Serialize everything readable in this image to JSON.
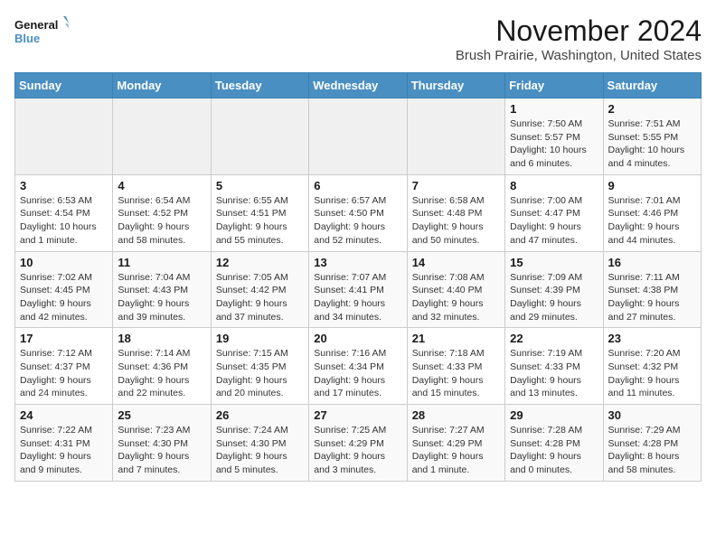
{
  "logo": {
    "line1": "General",
    "line2": "Blue"
  },
  "title": "November 2024",
  "subtitle": "Brush Prairie, Washington, United States",
  "days_of_week": [
    "Sunday",
    "Monday",
    "Tuesday",
    "Wednesday",
    "Thursday",
    "Friday",
    "Saturday"
  ],
  "weeks": [
    [
      {
        "day": "",
        "info": ""
      },
      {
        "day": "",
        "info": ""
      },
      {
        "day": "",
        "info": ""
      },
      {
        "day": "",
        "info": ""
      },
      {
        "day": "",
        "info": ""
      },
      {
        "day": "1",
        "info": "Sunrise: 7:50 AM\nSunset: 5:57 PM\nDaylight: 10 hours and 6 minutes."
      },
      {
        "day": "2",
        "info": "Sunrise: 7:51 AM\nSunset: 5:55 PM\nDaylight: 10 hours and 4 minutes."
      }
    ],
    [
      {
        "day": "3",
        "info": "Sunrise: 6:53 AM\nSunset: 4:54 PM\nDaylight: 10 hours and 1 minute."
      },
      {
        "day": "4",
        "info": "Sunrise: 6:54 AM\nSunset: 4:52 PM\nDaylight: 9 hours and 58 minutes."
      },
      {
        "day": "5",
        "info": "Sunrise: 6:55 AM\nSunset: 4:51 PM\nDaylight: 9 hours and 55 minutes."
      },
      {
        "day": "6",
        "info": "Sunrise: 6:57 AM\nSunset: 4:50 PM\nDaylight: 9 hours and 52 minutes."
      },
      {
        "day": "7",
        "info": "Sunrise: 6:58 AM\nSunset: 4:48 PM\nDaylight: 9 hours and 50 minutes."
      },
      {
        "day": "8",
        "info": "Sunrise: 7:00 AM\nSunset: 4:47 PM\nDaylight: 9 hours and 47 minutes."
      },
      {
        "day": "9",
        "info": "Sunrise: 7:01 AM\nSunset: 4:46 PM\nDaylight: 9 hours and 44 minutes."
      }
    ],
    [
      {
        "day": "10",
        "info": "Sunrise: 7:02 AM\nSunset: 4:45 PM\nDaylight: 9 hours and 42 minutes."
      },
      {
        "day": "11",
        "info": "Sunrise: 7:04 AM\nSunset: 4:43 PM\nDaylight: 9 hours and 39 minutes."
      },
      {
        "day": "12",
        "info": "Sunrise: 7:05 AM\nSunset: 4:42 PM\nDaylight: 9 hours and 37 minutes."
      },
      {
        "day": "13",
        "info": "Sunrise: 7:07 AM\nSunset: 4:41 PM\nDaylight: 9 hours and 34 minutes."
      },
      {
        "day": "14",
        "info": "Sunrise: 7:08 AM\nSunset: 4:40 PM\nDaylight: 9 hours and 32 minutes."
      },
      {
        "day": "15",
        "info": "Sunrise: 7:09 AM\nSunset: 4:39 PM\nDaylight: 9 hours and 29 minutes."
      },
      {
        "day": "16",
        "info": "Sunrise: 7:11 AM\nSunset: 4:38 PM\nDaylight: 9 hours and 27 minutes."
      }
    ],
    [
      {
        "day": "17",
        "info": "Sunrise: 7:12 AM\nSunset: 4:37 PM\nDaylight: 9 hours and 24 minutes."
      },
      {
        "day": "18",
        "info": "Sunrise: 7:14 AM\nSunset: 4:36 PM\nDaylight: 9 hours and 22 minutes."
      },
      {
        "day": "19",
        "info": "Sunrise: 7:15 AM\nSunset: 4:35 PM\nDaylight: 9 hours and 20 minutes."
      },
      {
        "day": "20",
        "info": "Sunrise: 7:16 AM\nSunset: 4:34 PM\nDaylight: 9 hours and 17 minutes."
      },
      {
        "day": "21",
        "info": "Sunrise: 7:18 AM\nSunset: 4:33 PM\nDaylight: 9 hours and 15 minutes."
      },
      {
        "day": "22",
        "info": "Sunrise: 7:19 AM\nSunset: 4:33 PM\nDaylight: 9 hours and 13 minutes."
      },
      {
        "day": "23",
        "info": "Sunrise: 7:20 AM\nSunset: 4:32 PM\nDaylight: 9 hours and 11 minutes."
      }
    ],
    [
      {
        "day": "24",
        "info": "Sunrise: 7:22 AM\nSunset: 4:31 PM\nDaylight: 9 hours and 9 minutes."
      },
      {
        "day": "25",
        "info": "Sunrise: 7:23 AM\nSunset: 4:30 PM\nDaylight: 9 hours and 7 minutes."
      },
      {
        "day": "26",
        "info": "Sunrise: 7:24 AM\nSunset: 4:30 PM\nDaylight: 9 hours and 5 minutes."
      },
      {
        "day": "27",
        "info": "Sunrise: 7:25 AM\nSunset: 4:29 PM\nDaylight: 9 hours and 3 minutes."
      },
      {
        "day": "28",
        "info": "Sunrise: 7:27 AM\nSunset: 4:29 PM\nDaylight: 9 hours and 1 minute."
      },
      {
        "day": "29",
        "info": "Sunrise: 7:28 AM\nSunset: 4:28 PM\nDaylight: 9 hours and 0 minutes."
      },
      {
        "day": "30",
        "info": "Sunrise: 7:29 AM\nSunset: 4:28 PM\nDaylight: 8 hours and 58 minutes."
      }
    ]
  ]
}
